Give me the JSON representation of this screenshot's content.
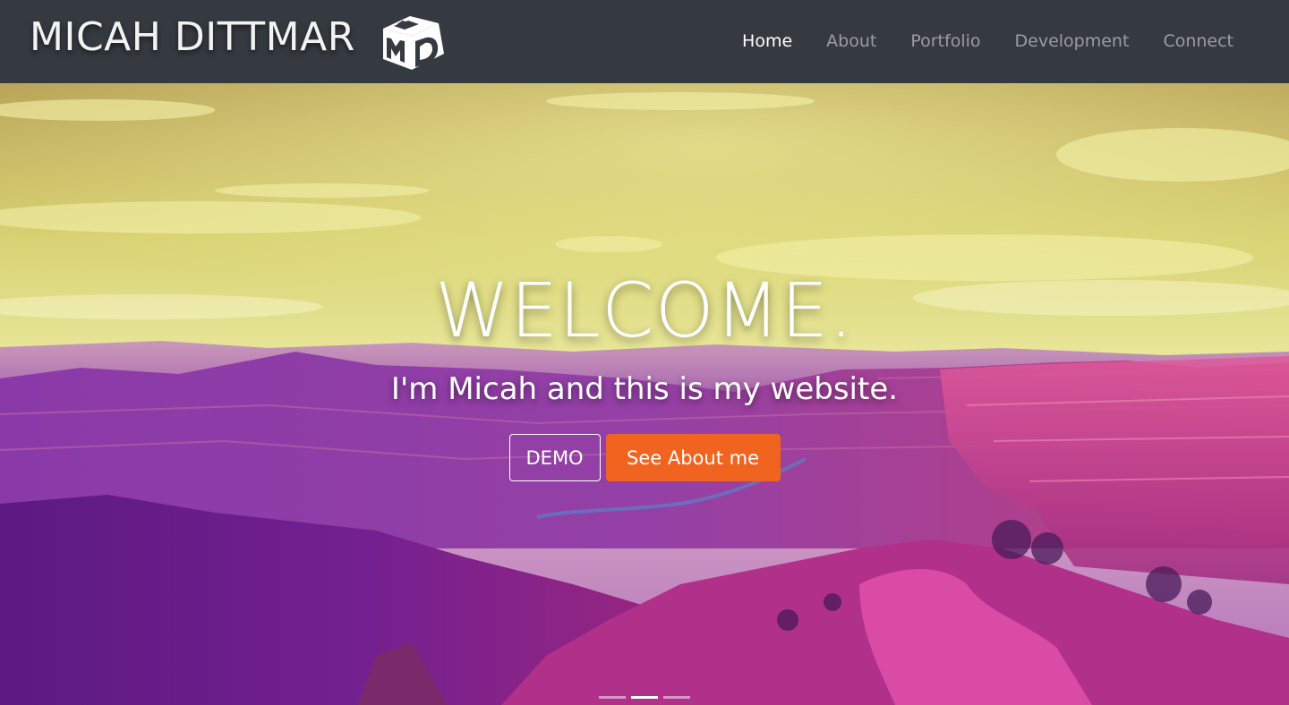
{
  "brand": {
    "name": "MICAH DITTMAR",
    "logo_icon": "md-cube-logo-icon",
    "logo_letters": "MD"
  },
  "nav": {
    "items": [
      {
        "label": "Home",
        "active": true
      },
      {
        "label": "About",
        "active": false
      },
      {
        "label": "Portfolio",
        "active": false
      },
      {
        "label": "Development",
        "active": false
      },
      {
        "label": "Connect",
        "active": false
      }
    ]
  },
  "hero": {
    "title": "WELCOME.",
    "subtitle": "I'm Micah and this is my website.",
    "demo_button": "DEMO",
    "about_button": "See About me",
    "background_image": "canyon-landscape",
    "slides": 3,
    "active_slide": 2
  },
  "colors": {
    "navbar": "#343a40",
    "accent_orange": "#f0641f",
    "nav_active": "#ffffff",
    "nav_inactive": "#9a9da0"
  }
}
